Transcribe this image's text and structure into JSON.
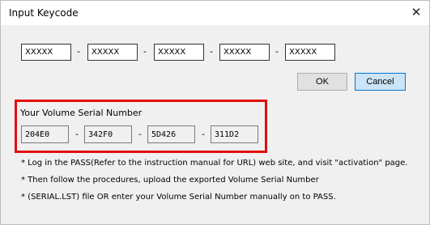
{
  "window": {
    "title": "Input Keycode",
    "close_glyph": "✕"
  },
  "keycode": {
    "fields": [
      "XXXXX",
      "XXXXX",
      "XXXXX",
      "XXXXX",
      "XXXXX"
    ],
    "separator": "-"
  },
  "buttons": {
    "ok": "OK",
    "cancel": "Cancel"
  },
  "serial": {
    "label": "Your Volume Serial Number",
    "parts": [
      "204E0",
      "342F0",
      "5D426",
      "311D2"
    ],
    "separator": "-",
    "highlight_color": "#e10e0e"
  },
  "notes": [
    "* Log in the PASS(Refer to the instruction manual for URL) web site, and visit \"activation\" page.",
    "* Then follow the procedures, upload the exported Volume Serial Number",
    "* (SERIAL.LST) file OR enter your Volume Serial Number manually on to PASS."
  ]
}
